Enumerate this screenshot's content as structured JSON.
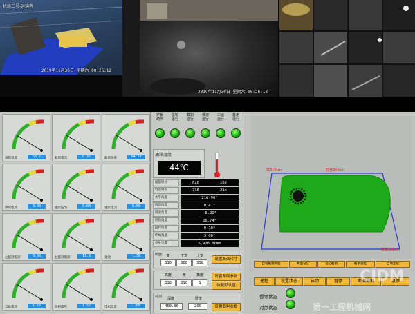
{
  "cctv": {
    "cam1": {
      "label": "机组二号-运输巷",
      "timestamp": "2019年11月30日 星期六 00:26:12"
    },
    "cam2": {
      "timestamp": "2019年11月30日 星期六 00:26:13"
    }
  },
  "gauges": [
    {
      "name": "滚筒温度",
      "value": "53.7"
    },
    {
      "name": "截割电流",
      "value": "0.35"
    },
    {
      "name": "截割功率",
      "value": "54.50"
    },
    {
      "name": "牵引电流",
      "value": "0.00"
    },
    {
      "name": "油泵压力",
      "value": "0.00"
    },
    {
      "name": "油泵电流",
      "value": "0.00"
    },
    {
      "name": "左截割电流",
      "value": "0.00"
    },
    {
      "name": "右截割电流",
      "value": "13.8"
    },
    {
      "name": "油温",
      "value": "1.38"
    },
    {
      "name": "三级电流",
      "value": "1.53"
    },
    {
      "name": "三相电压",
      "value": "1.55"
    },
    {
      "name": "电机温度",
      "value": "1.00"
    }
  ],
  "buttons": [
    {
      "top": "铲板\n动作",
      "color": "#17b20c"
    },
    {
      "top": "星轮\n运行",
      "color": "#17b20c"
    },
    {
      "top": "截割\n运行",
      "color": "#17b20c"
    },
    {
      "top": "低速\n运行",
      "color": "#17b20c"
    },
    {
      "top": "二运\n运行",
      "color": "#17b20c"
    },
    {
      "top": "备用\n运行",
      "color": "#17b20c"
    }
  ],
  "temperature": {
    "title": "油箱温度",
    "value": "44℃"
  },
  "params": [
    {
      "label": "截割时长",
      "a": "620",
      "b": "16s"
    },
    {
      "label": "行走时长",
      "a": "736",
      "b": "21s"
    },
    {
      "label": "水平角度",
      "value": "216.96°"
    },
    {
      "label": "俯仰角度",
      "value": "0.41°"
    },
    {
      "label": "翻滚角度",
      "value": "-0.91°"
    },
    {
      "label": "航向角度",
      "value": "26.74°"
    },
    {
      "label": "回转角度",
      "value": "0.10°"
    },
    {
      "label": "伸缩角度",
      "value": "3.00°"
    },
    {
      "label": "机身位置",
      "value": "6.978.00mm"
    }
  ],
  "section1": {
    "title": "断面",
    "headers": [
      "高",
      "下宽",
      "上宽"
    ],
    "values": [
      "310",
      "360",
      "338"
    ],
    "button": "设置断面尺寸"
  },
  "section2": {
    "headers": [
      "高度",
      "宽",
      "角度"
    ],
    "values": [
      "338",
      "310",
      "1"
    ],
    "button1": "设置断面参数",
    "button2": "恢复默认值"
  },
  "section3": {
    "title": "截割",
    "headers": [
      "深度",
      "厚度"
    ],
    "values": [
      "450.00",
      "200"
    ],
    "button": "设置截割参数"
  },
  "view": {
    "top_left": "高310cm",
    "top_right": "顶宽360cm",
    "bottom_right": "底宽338cm"
  },
  "strip": [
    "自动截割断面",
    "断面记忆",
    "记忆截割",
    "截割到位",
    "自动定位"
  ],
  "strip2": [
    "遥控",
    "设置状态",
    "启动",
    "暂停",
    "断面截割",
    "急停"
  ],
  "bottom": {
    "l1": "惯导状态",
    "l2": "对点状态"
  },
  "watermark": {
    "line1": "CIDM",
    "line2": "第一工程机械网"
  }
}
